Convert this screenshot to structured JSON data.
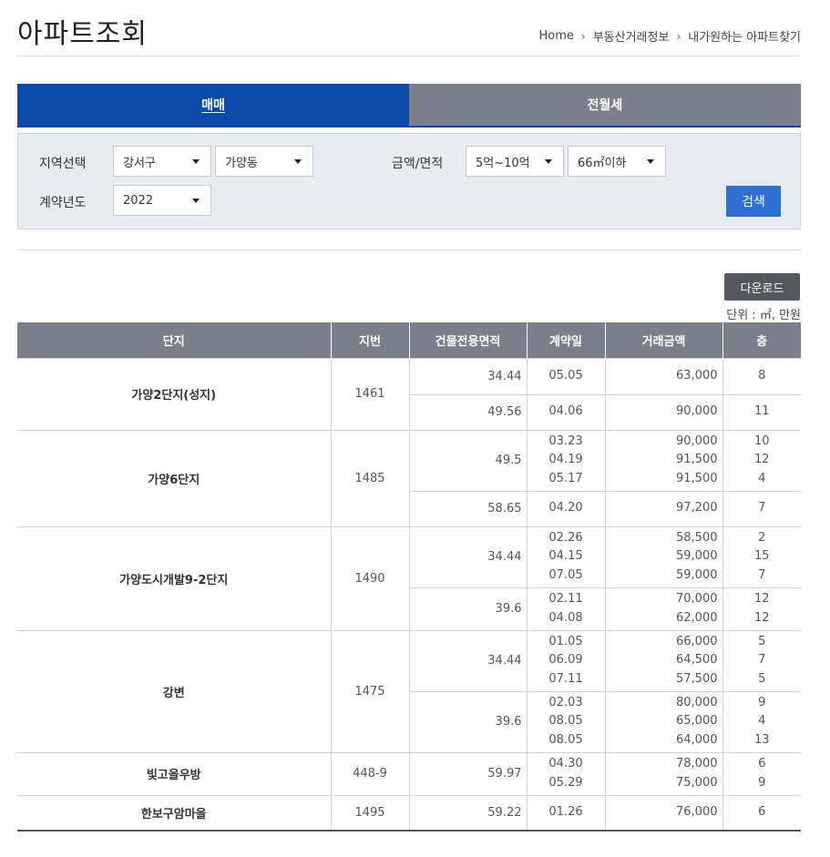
{
  "page": {
    "title": "아파트조회",
    "breadcrumb": [
      "Home",
      "부동산거래정보",
      "내가원하는 아파트찾기"
    ]
  },
  "tabs": [
    {
      "label": "매매",
      "active": true
    },
    {
      "label": "전월세",
      "active": false
    }
  ],
  "filters": {
    "region_label": "지역선택",
    "gu": "강서구",
    "dong": "가양동",
    "price_area_label": "금액/면적",
    "price": "5억~10억",
    "area": "66㎡이하",
    "year_label": "계약년도",
    "year": "2022",
    "search_label": "검색"
  },
  "download_label": "다운로드",
  "unit_note": "단위 : ㎡, 만원",
  "colors": {
    "primary": "#0a4aab",
    "header_gray": "#7b7f8c",
    "search_blue": "#2e6fd6",
    "download_dark": "#54575f"
  },
  "table": {
    "headers": [
      "단지",
      "지번",
      "건물전용면적",
      "계약일",
      "거래금액",
      "층"
    ],
    "complexes": [
      {
        "name": "가양2단지(성지)",
        "jibun": "1461",
        "areas": [
          {
            "area": "34.44",
            "trades": [
              {
                "date": "05.05",
                "price": "63,000",
                "floor": "8"
              }
            ]
          },
          {
            "area": "49.56",
            "trades": [
              {
                "date": "04.06",
                "price": "90,000",
                "floor": "11"
              }
            ]
          }
        ]
      },
      {
        "name": "가양6단지",
        "jibun": "1485",
        "areas": [
          {
            "area": "49.5",
            "trades": [
              {
                "date": "03.23",
                "price": "90,000",
                "floor": "10"
              },
              {
                "date": "04.19",
                "price": "91,500",
                "floor": "12"
              },
              {
                "date": "05.17",
                "price": "91,500",
                "floor": "4"
              }
            ]
          },
          {
            "area": "58.65",
            "trades": [
              {
                "date": "04.20",
                "price": "97,200",
                "floor": "7"
              }
            ]
          }
        ]
      },
      {
        "name": "가양도시개발9-2단지",
        "jibun": "1490",
        "areas": [
          {
            "area": "34.44",
            "trades": [
              {
                "date": "02.26",
                "price": "58,500",
                "floor": "2"
              },
              {
                "date": "04.15",
                "price": "59,000",
                "floor": "15"
              },
              {
                "date": "07.05",
                "price": "59,000",
                "floor": "7"
              }
            ]
          },
          {
            "area": "39.6",
            "trades": [
              {
                "date": "02.11",
                "price": "70,000",
                "floor": "12"
              },
              {
                "date": "04.08",
                "price": "62,000",
                "floor": "12"
              }
            ]
          }
        ]
      },
      {
        "name": "강변",
        "jibun": "1475",
        "areas": [
          {
            "area": "34.44",
            "trades": [
              {
                "date": "01.05",
                "price": "66,000",
                "floor": "5"
              },
              {
                "date": "06.09",
                "price": "64,500",
                "floor": "7"
              },
              {
                "date": "07.11",
                "price": "57,500",
                "floor": "5"
              }
            ]
          },
          {
            "area": "39.6",
            "trades": [
              {
                "date": "02.03",
                "price": "80,000",
                "floor": "9"
              },
              {
                "date": "08.05",
                "price": "65,000",
                "floor": "4"
              },
              {
                "date": "08.05",
                "price": "64,000",
                "floor": "13"
              }
            ]
          }
        ]
      },
      {
        "name": "빛고을우방",
        "jibun": "448-9",
        "areas": [
          {
            "area": "59.97",
            "trades": [
              {
                "date": "04.30",
                "price": "78,000",
                "floor": "6"
              },
              {
                "date": "05.29",
                "price": "75,000",
                "floor": "9"
              }
            ]
          }
        ]
      },
      {
        "name": "한보구암마을",
        "jibun": "1495",
        "areas": [
          {
            "area": "59.22",
            "trades": [
              {
                "date": "01.26",
                "price": "76,000",
                "floor": "6"
              }
            ]
          }
        ]
      }
    ]
  }
}
